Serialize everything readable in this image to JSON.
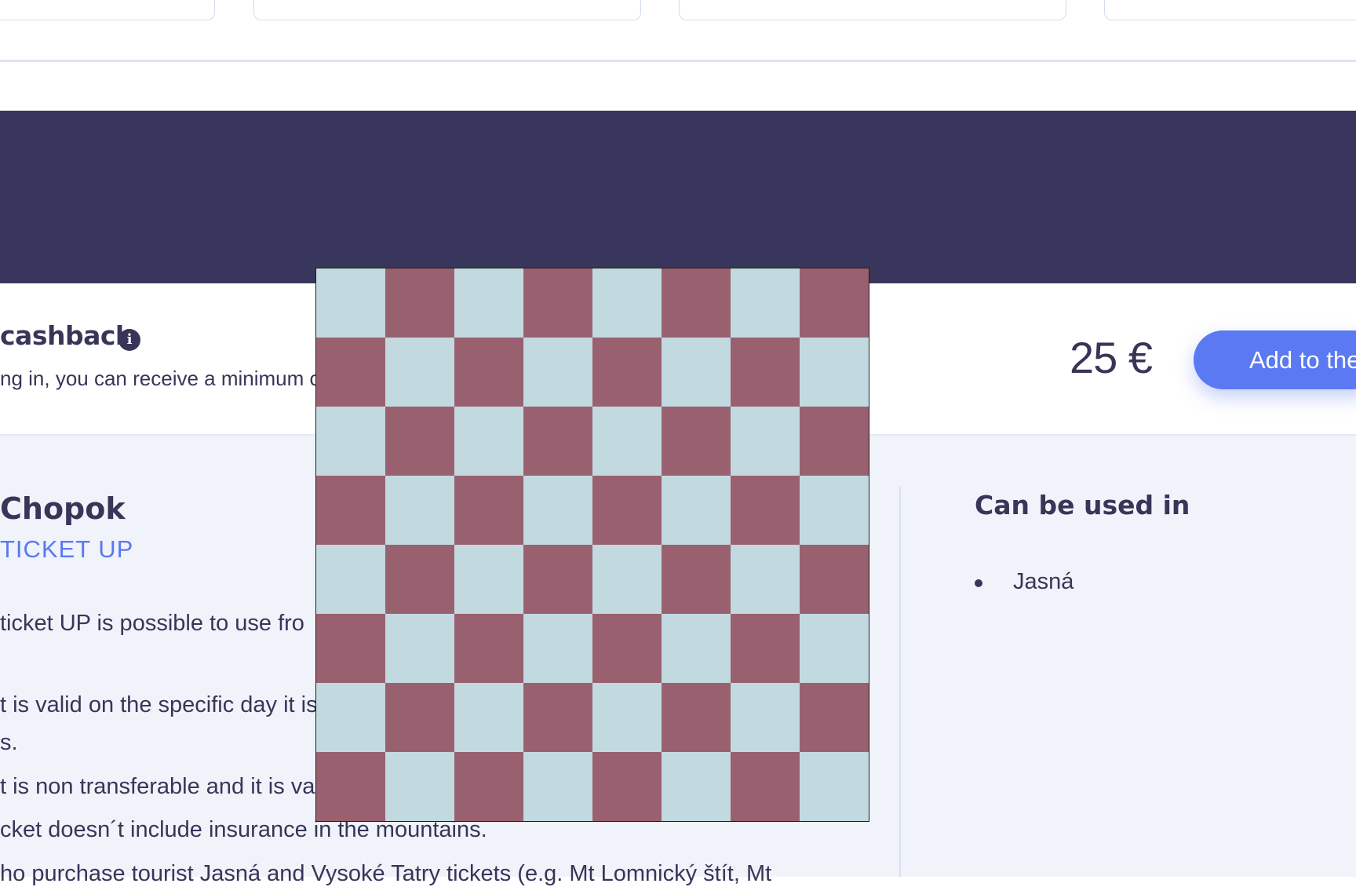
{
  "colors": {
    "navy": "#38365c",
    "accent": "#5a79f2",
    "text": "#373658",
    "details_bg": "#f1f3fb",
    "checker_light": "#c2d9e0",
    "checker_dark": "#996170"
  },
  "product": {
    "title": "cashback",
    "info_icon": "info-icon",
    "info_glyph": "i",
    "description": "ng in, you can receive a minimum c",
    "price": "25 €",
    "add_label": "Add to the"
  },
  "ticket": {
    "title": "Chopok",
    "subtitle": "TICKET UP",
    "lines": [
      "ticket UP is possible to use fro",
      "t is valid on the specific day it is",
      "s.",
      "t is non transferable and it is va",
      "cket doesn´t include insurance in the mountains.",
      "ho purchase tourist Jasná and Vysoké Tatry tickets (e.g. Mt Lomnický štít, Mt"
    ]
  },
  "usage": {
    "title": "Can be used in",
    "items": [
      "Jasná"
    ]
  },
  "overlay": {
    "rows": 8,
    "cols": 8
  }
}
